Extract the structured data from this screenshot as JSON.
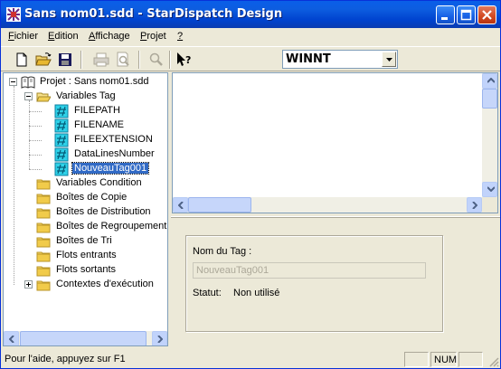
{
  "window": {
    "title": "Sans nom01.sdd - StarDispatch Design",
    "accent": "#0a5ee8",
    "selection_color": "#316ac5"
  },
  "menu": {
    "items": [
      {
        "label": "Fichier",
        "mnemonic": "F",
        "rest": "ichier"
      },
      {
        "label": "Edition",
        "mnemonic": "E",
        "rest": "dition"
      },
      {
        "label": "Affichage",
        "mnemonic": "A",
        "rest": "ffichage"
      },
      {
        "label": "Projet",
        "mnemonic": "P",
        "rest": "rojet"
      },
      {
        "label": "?",
        "mnemonic": "?",
        "rest": ""
      }
    ]
  },
  "toolbar": {
    "icons": [
      "new-file-icon",
      "open-folder-icon",
      "save-icon",
      "print-icon",
      "print-preview-icon",
      "find-icon",
      "context-help-icon"
    ],
    "environment_select": "WINNT"
  },
  "tree": {
    "root": "Projet : Sans nom01.sdd",
    "variables_tag": "Variables Tag",
    "tags": [
      "FILEPATH",
      "FILENAME",
      "FILEEXTENSION",
      "DataLinesNumber",
      "NouveauTag001"
    ],
    "selected_tag": "NouveauTag001",
    "folders": [
      "Variables Condition",
      "Boîtes de Copie",
      "Boîtes de Distribution",
      "Boîtes de Regroupement",
      "Boîtes de Tri",
      "Flots entrants",
      "Flots sortants",
      "Contextes d'exécution"
    ]
  },
  "detail": {
    "tag_name_label": "Nom du Tag :",
    "tag_name_value": "NouveauTag001",
    "status_label": "Statut:",
    "status_value": "Non utilisé"
  },
  "statusbar": {
    "help_text": "Pour l'aide, appuyez sur F1",
    "num_indicator": "NUM"
  }
}
